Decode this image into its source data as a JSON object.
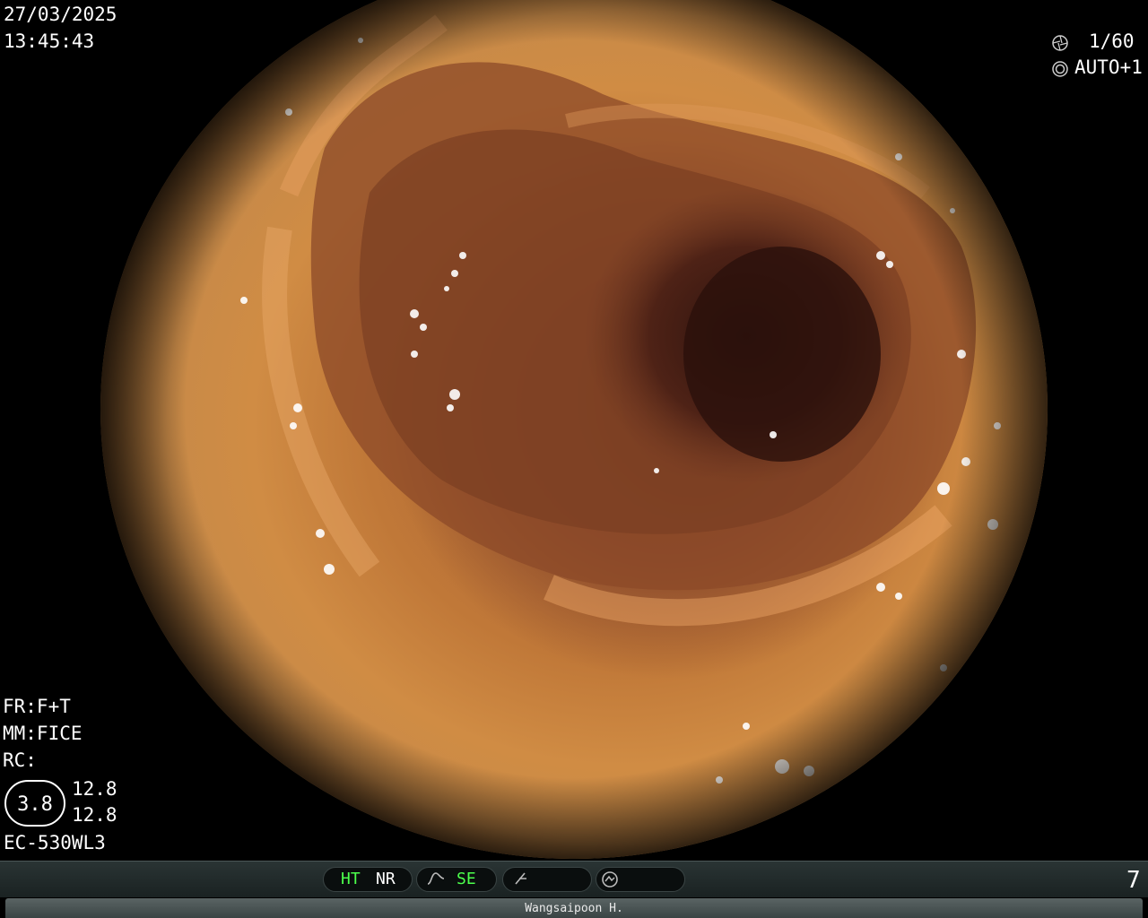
{
  "header": {
    "date": "27/03/2025",
    "time": "13:45:43"
  },
  "top_right": {
    "shutter_icon": "aperture-icon",
    "shutter": "1/60",
    "iris_icon": "iris-icon",
    "iris_mode": "AUTO+1"
  },
  "bottom_left": {
    "fr": "FR:F+T",
    "mm": "MM:FICE",
    "rc": "RC:",
    "zoom_value": "3.8",
    "value_a": "12.8",
    "value_b": "12.8",
    "scope_model": "EC-530WL3"
  },
  "status_bar": {
    "ht": "HT",
    "nr": "NR",
    "curve_icon": "curve-icon",
    "se": "SE",
    "slash_icon": "slash-icon",
    "dial_icon": "dial-icon",
    "page_number": "7"
  },
  "footer": {
    "operator": "Wangsaipoon H."
  },
  "colors": {
    "active_mode": "#4cff4c",
    "text": "#ffffff",
    "background": "#000000"
  }
}
